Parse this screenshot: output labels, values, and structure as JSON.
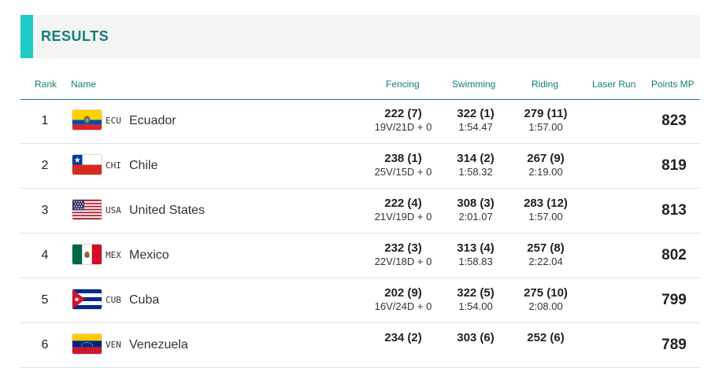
{
  "header": {
    "title": "RESULTS"
  },
  "columns": {
    "rank": "Rank",
    "name": "Name",
    "fencing": "Fencing",
    "swimming": "Swimming",
    "riding": "Riding",
    "laser_run": "Laser Run",
    "points": "Points MP"
  },
  "rows": [
    {
      "rank": "1",
      "code": "ECU",
      "country": "Ecuador",
      "flag": "ecuador-flag-icon",
      "fencing_main": "222 (7)",
      "fencing_sub": "19V/21D + 0",
      "swimming_main": "322 (1)",
      "swimming_sub": "1:54.47",
      "riding_main": "279 (11)",
      "riding_sub": "1:57.00",
      "points": "823"
    },
    {
      "rank": "2",
      "code": "CHI",
      "country": "Chile",
      "flag": "chile-flag-icon",
      "fencing_main": "238 (1)",
      "fencing_sub": "25V/15D + 0",
      "swimming_main": "314 (2)",
      "swimming_sub": "1:58.32",
      "riding_main": "267 (9)",
      "riding_sub": "2:19.00",
      "points": "819"
    },
    {
      "rank": "3",
      "code": "USA",
      "country": "United States",
      "flag": "usa-flag-icon",
      "fencing_main": "222 (4)",
      "fencing_sub": "21V/19D + 0",
      "swimming_main": "308 (3)",
      "swimming_sub": "2:01.07",
      "riding_main": "283 (12)",
      "riding_sub": "1:57.00",
      "points": "813"
    },
    {
      "rank": "4",
      "code": "MEX",
      "country": "Mexico",
      "flag": "mexico-flag-icon",
      "fencing_main": "232 (3)",
      "fencing_sub": "22V/18D + 0",
      "swimming_main": "313 (4)",
      "swimming_sub": "1:58.83",
      "riding_main": "257 (8)",
      "riding_sub": "2:22.04",
      "points": "802"
    },
    {
      "rank": "5",
      "code": "CUB",
      "country": "Cuba",
      "flag": "cuba-flag-icon",
      "fencing_main": "202 (9)",
      "fencing_sub": "16V/24D + 0",
      "swimming_main": "322 (5)",
      "swimming_sub": "1:54.00",
      "riding_main": "275 (10)",
      "riding_sub": "2:08.00",
      "points": "799"
    },
    {
      "rank": "6",
      "code": "VEN",
      "country": "Venezuela",
      "flag": "venezuela-flag-icon",
      "fencing_main": "234 (2)",
      "fencing_sub": "",
      "swimming_main": "303 (6)",
      "swimming_sub": "",
      "riding_main": "252 (6)",
      "riding_sub": "",
      "points": "789"
    }
  ]
}
